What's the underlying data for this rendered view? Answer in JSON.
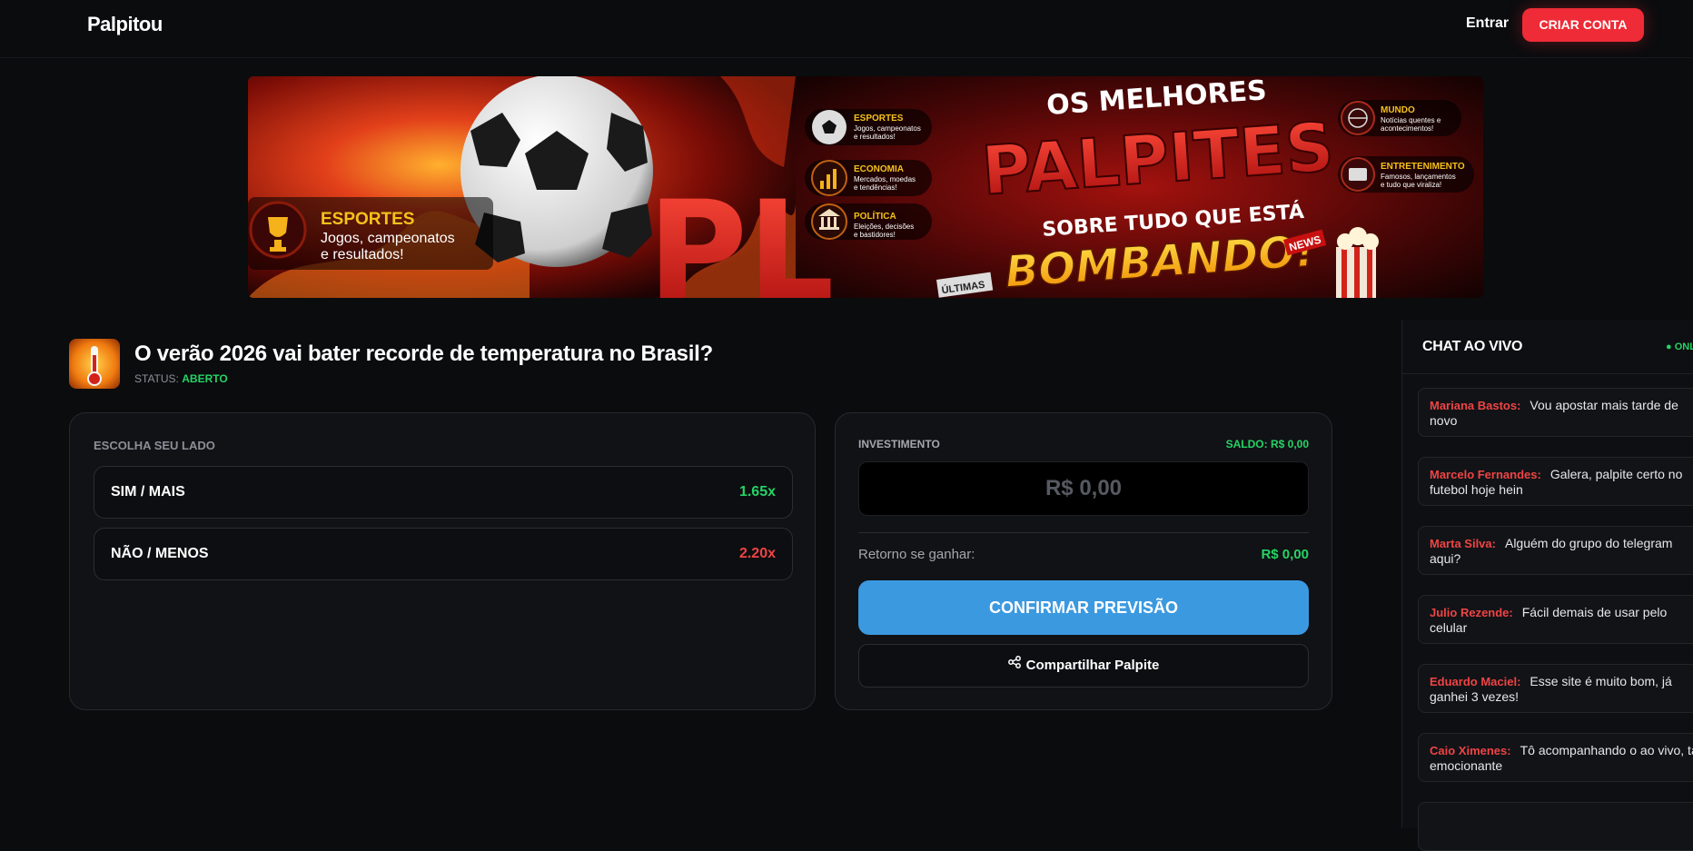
{
  "header": {
    "logo": "Palpitou",
    "login_label": "Entrar",
    "signup_label": "CRIAR CONTA"
  },
  "banner": {
    "left_category": "ESPORTES",
    "left_desc_1": "Jogos, campeonatos",
    "left_desc_2": "e resultados!",
    "big_letters": "PL",
    "headline_1": "OS MELHORES",
    "headline_2": "PALPITES",
    "headline_3": "SOBRE TUDO QUE ESTÁ",
    "headline_4": "BOMBANDO!",
    "news_tag": "NEWS",
    "ultimas": "ÚLTIMAS",
    "categories": [
      {
        "title": "ESPORTES",
        "line1": "Jogos, campeonatos",
        "line2": "e resultados!"
      },
      {
        "title": "ECONOMIA",
        "line1": "Mercados, moedas",
        "line2": "e tendências!"
      },
      {
        "title": "POLÍTICA",
        "line1": "Eleições, decisões",
        "line2": "e bastidores!"
      },
      {
        "title": "MUNDO",
        "line1": "Notícias quentes e",
        "line2": "acontecimentos!"
      },
      {
        "title": "ENTRETENIMENTO",
        "line1": "Famosos, lançamentos",
        "line2": "e tudo que viraliza!"
      }
    ]
  },
  "question": {
    "title": "O verão 2026 vai bater recorde de temperatura no Brasil?",
    "status_label": "STATUS:",
    "status_value": "ABERTO"
  },
  "sides": {
    "title": "ESCOLHA SEU LADO",
    "options": [
      {
        "label": "SIM / MAIS",
        "odds": "1.65x"
      },
      {
        "label": "NÃO / MENOS",
        "odds": "2.20x"
      }
    ]
  },
  "investment": {
    "label": "INVESTIMENTO",
    "balance": "SALDO: R$ 0,00",
    "amount_placeholder": "R$ 0,00",
    "return_label": "Retorno se ganhar:",
    "return_value": "R$ 0,00",
    "confirm_label": "CONFIRMAR PREVISÃO",
    "share_label": "Compartilhar Palpite"
  },
  "chat": {
    "title": "CHAT AO VIVO",
    "online_label": "● ONLINE",
    "messages": [
      {
        "user": "Mariana Bastos:",
        "text": "Vou apostar mais tarde de novo"
      },
      {
        "user": "Marcelo Fernandes:",
        "text": "Galera, palpite certo no futebol hoje hein"
      },
      {
        "user": "Marta Silva:",
        "text": "Alguém do grupo do telegram aqui?"
      },
      {
        "user": "Julio Rezende:",
        "text": "Fácil demais de usar pelo celular"
      },
      {
        "user": "Eduardo Maciel:",
        "text": "Esse site é muito bom, já ganhei 3 vezes!"
      },
      {
        "user": "Caio Ximenes:",
        "text": "Tô acompanhando o ao vivo, tá emocionante"
      }
    ]
  },
  "colors": {
    "accent_red": "#ee2b36",
    "success_green": "#25d366",
    "danger_red": "#ef4444",
    "confirm_blue": "#3b99e0"
  }
}
